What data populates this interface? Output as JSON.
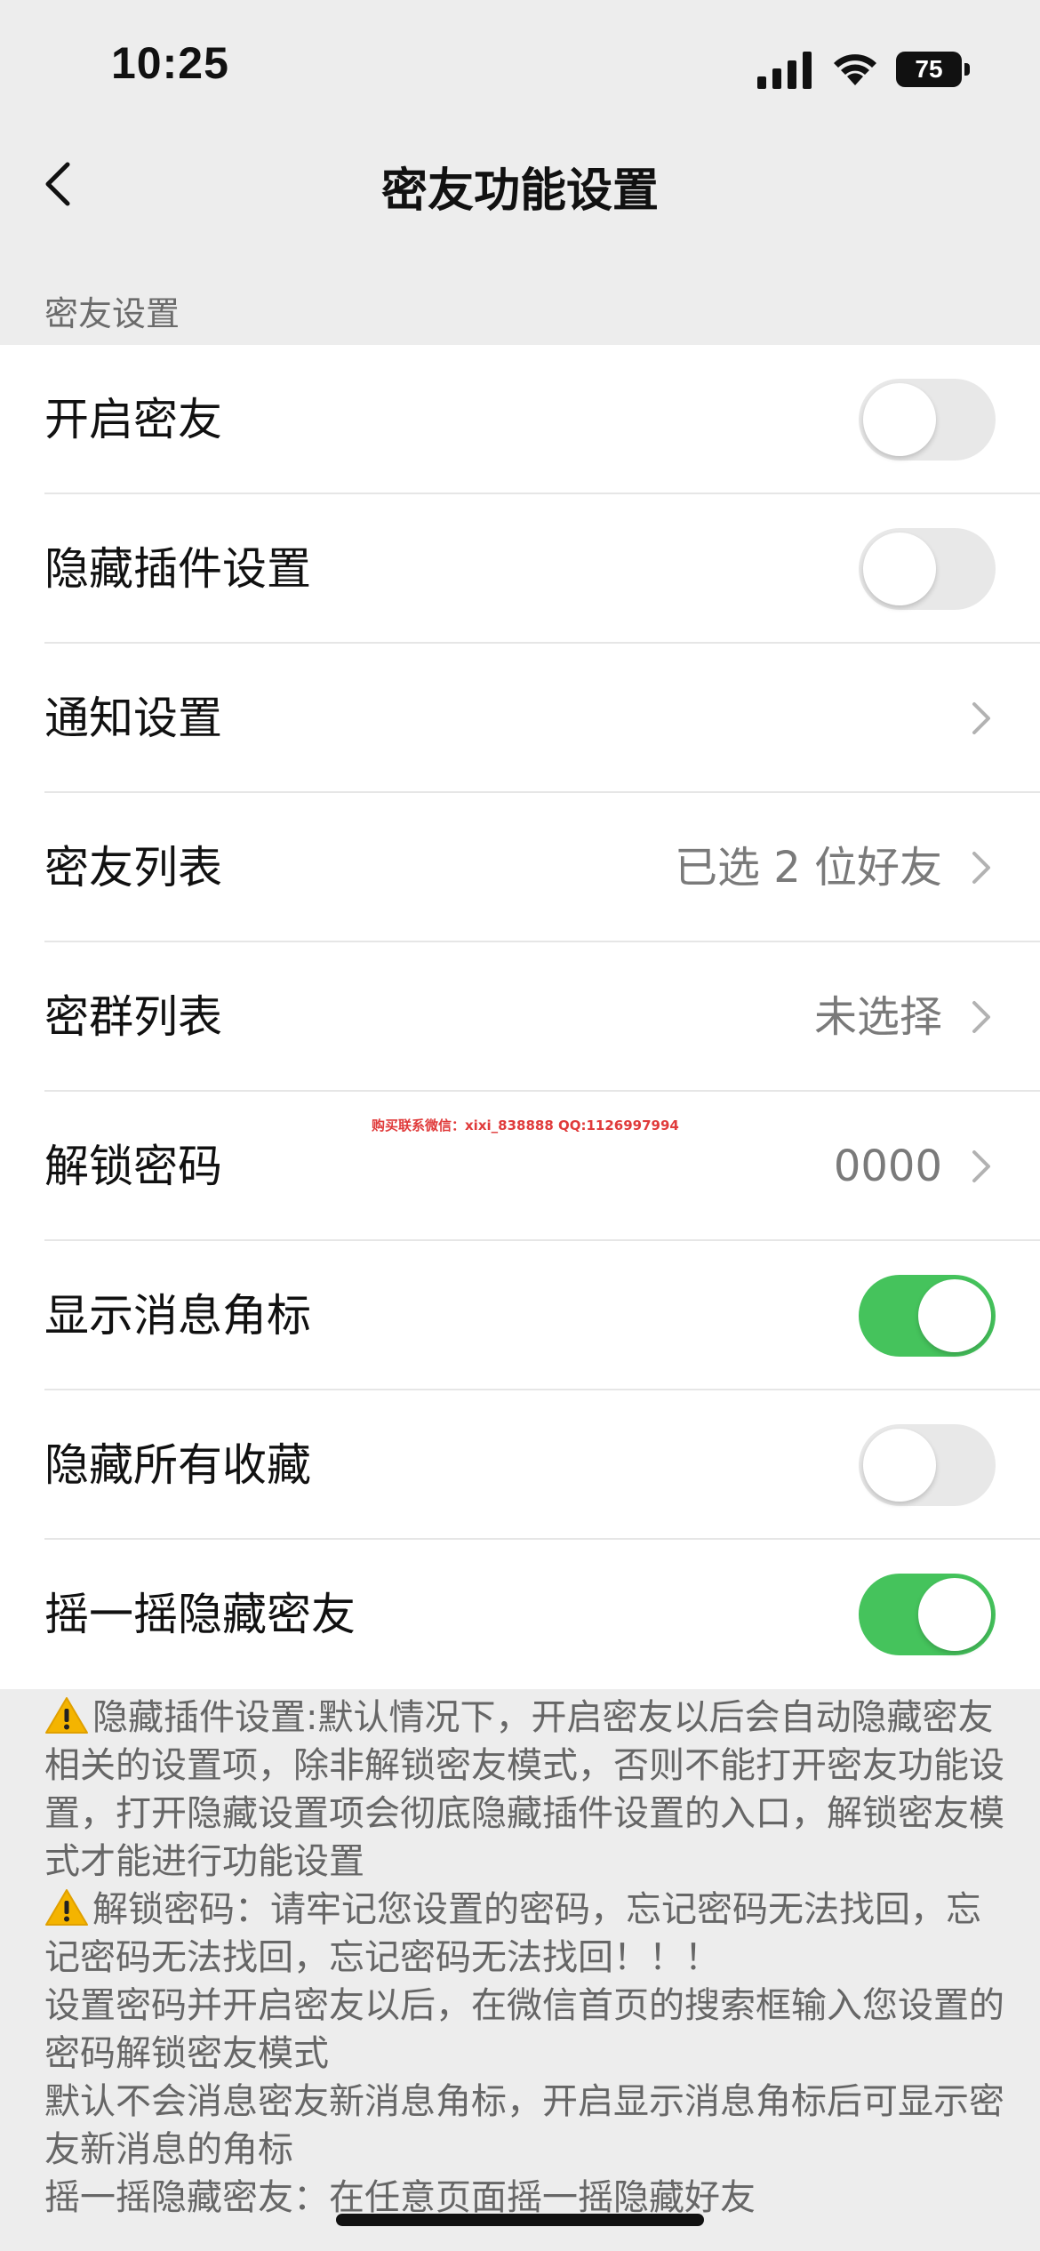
{
  "status_bar": {
    "time": "10:25",
    "battery": "75",
    "icons": [
      "signal-icon",
      "wifi-icon",
      "battery-icon"
    ]
  },
  "nav": {
    "title": "密友功能设置",
    "back_icon": "chevron-left-icon"
  },
  "section": {
    "header": "密友设置"
  },
  "rows": [
    {
      "label": "开启密友",
      "type": "toggle",
      "on": false
    },
    {
      "label": "隐藏插件设置",
      "type": "toggle",
      "on": false
    },
    {
      "label": "通知设置",
      "type": "link",
      "value": ""
    },
    {
      "label": "密友列表",
      "type": "link",
      "value": "已选 2 位好友"
    },
    {
      "label": "密群列表",
      "type": "link",
      "value": "未选择"
    },
    {
      "label": "解锁密码",
      "type": "link",
      "value": "0000"
    },
    {
      "label": "显示消息角标",
      "type": "toggle",
      "on": true
    },
    {
      "label": "隐藏所有收藏",
      "type": "toggle",
      "on": false
    },
    {
      "label": "摇一摇隐藏密友",
      "type": "toggle",
      "on": true
    }
  ],
  "watermark": "购买联系微信：xixi_838888    QQ:1126997994",
  "notes": [
    {
      "warn": true,
      "text": "隐藏插件设置:默认情况下，开启密友以后会自动隐藏密友相关的设置项，除非解锁密友模式，否则不能打开密友功能设置，打开隐藏设置项会彻底隐藏插件设置的入口，解锁密友模式才能进行功能设置"
    },
    {
      "warn": true,
      "text": "解锁密码：请牢记您设置的密码，忘记密码无法找回，忘记密码无法找回，忘记密码无法找回！！！"
    },
    {
      "warn": false,
      "text": "设置密码并开启密友以后，在微信首页的搜索框输入您设置的密码解锁密友模式"
    },
    {
      "warn": false,
      "text": "默认不会消息密友新消息角标，开启显示消息角标后可显示密友新消息的角标"
    },
    {
      "warn": false,
      "text": "摇一摇隐藏密友：在任意页面摇一摇隐藏好友"
    }
  ],
  "colors": {
    "toggle_on": "#45c35c",
    "toggle_off": "#e8e8e8",
    "background": "#ededed",
    "warning": "#f4b400"
  }
}
